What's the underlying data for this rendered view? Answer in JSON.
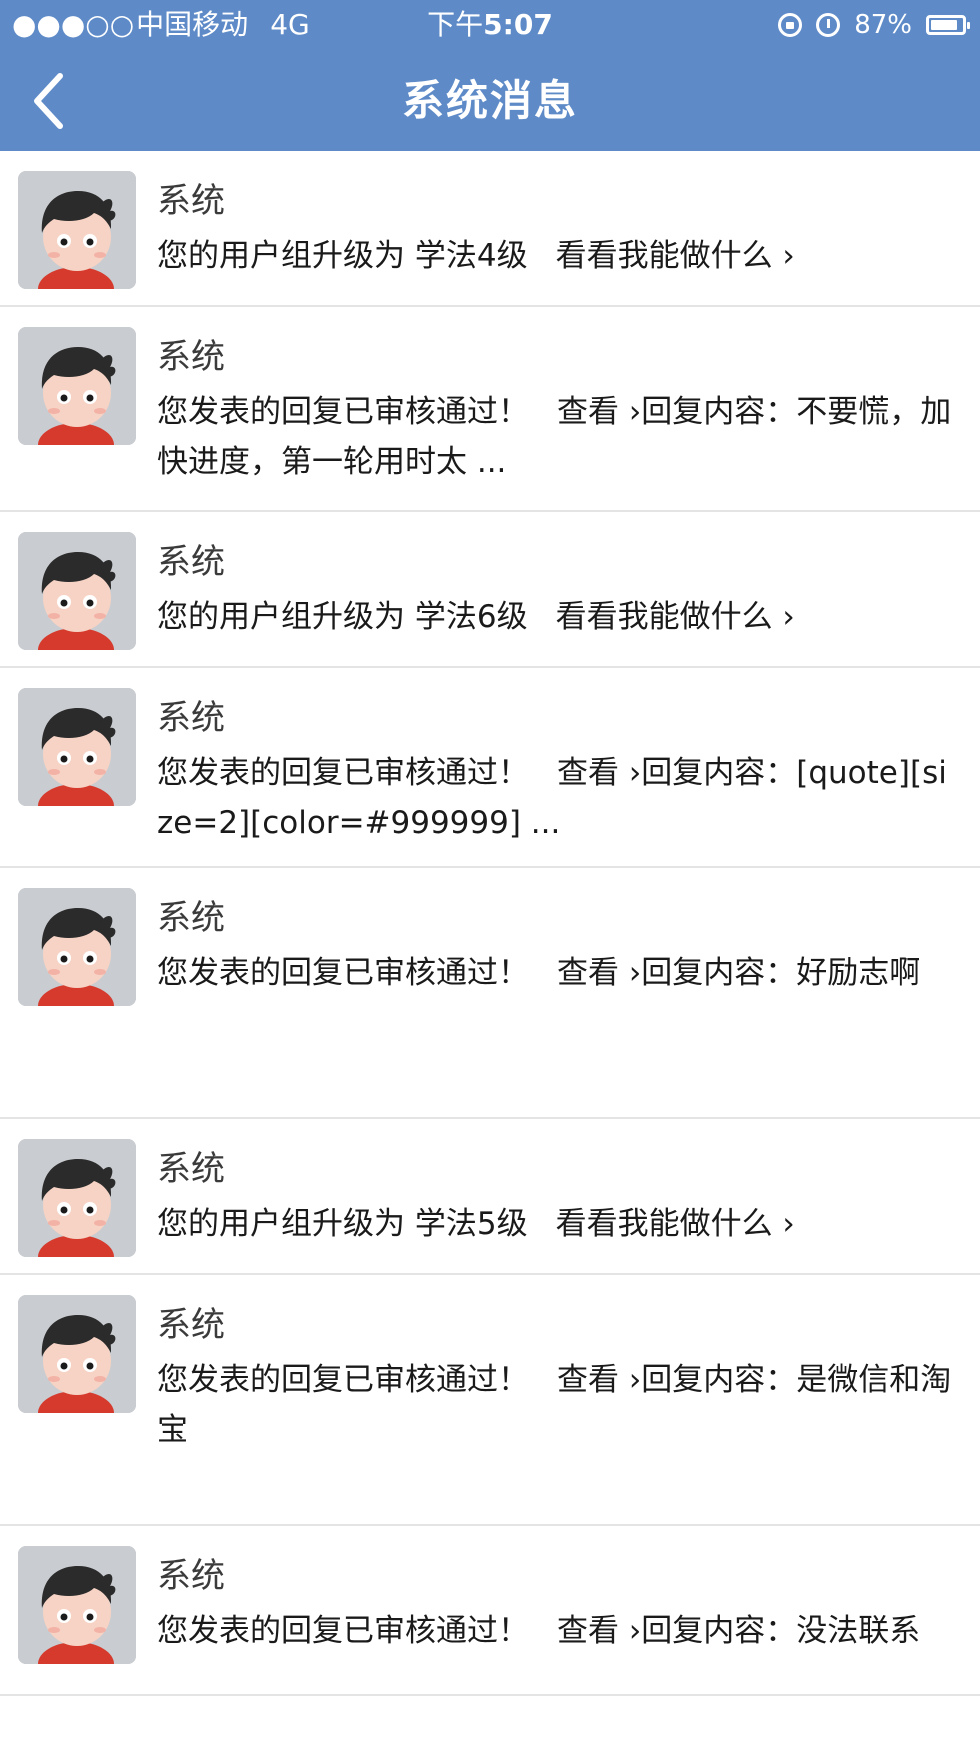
{
  "status_bar": {
    "signal": "●●●○○",
    "carrier": "中国移动",
    "network": "4G",
    "time_prefix": "下午",
    "time": "5:07",
    "battery_text": "87%"
  },
  "nav": {
    "title": "系统消息",
    "back_icon": "chevron-left-icon"
  },
  "messages": [
    {
      "sender": "系统",
      "text": "您的用户组升级为 学法4级",
      "link": "看看我能做什么 ›",
      "extra": ""
    },
    {
      "sender": "系统",
      "text": "您发表的回复已审核通过！",
      "link": "查看 ›",
      "extra": "回复内容：不要慌，加快进度，第一轮用时太 ..."
    },
    {
      "sender": "系统",
      "text": "您的用户组升级为 学法6级",
      "link": "看看我能做什么 ›",
      "extra": ""
    },
    {
      "sender": "系统",
      "text": "您发表的回复已审核通过！",
      "link": "查看 ›",
      "extra": "回复内容：[quote][size=2][color=#999999] ..."
    },
    {
      "sender": "系统",
      "text": "您发表的回复已审核通过！",
      "link": "查看 ›",
      "extra": "回复内容：好励志啊"
    },
    {
      "sender": "系统",
      "text": "您的用户组升级为 学法5级",
      "link": "看看我能做什么 ›",
      "extra": ""
    },
    {
      "sender": "系统",
      "text": "您发表的回复已审核通过！",
      "link": "查看 ›",
      "extra": "回复内容：是微信和淘宝"
    },
    {
      "sender": "系统",
      "text": "您发表的回复已审核通过！",
      "link": "查看 ›",
      "extra": "回复内容：没法联系"
    }
  ],
  "colors": {
    "header_bg": "#5e8bc8",
    "divider": "#e4e4e4",
    "avatar_bg": "#c7cacd"
  }
}
